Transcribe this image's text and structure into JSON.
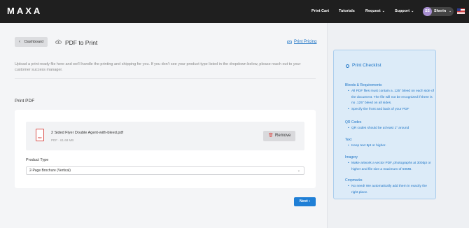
{
  "brand": "MAXA",
  "nav": [
    {
      "label": "Print Cart"
    },
    {
      "label": "Tutorials"
    },
    {
      "label": "Request"
    },
    {
      "label": "Support"
    }
  ],
  "user": {
    "initials": "SS",
    "name": "Sherin"
  },
  "header": {
    "back_label": "Dashboard",
    "title": "PDF to Print",
    "pricing_label": "Print Pricing"
  },
  "intro": "Upload a print-ready file here and we'll handle the printing and shipping for you. If you don't see your product type listed in the dropdown below, please reach out to your customer success manager.",
  "section_label": "Print PDF",
  "file": {
    "icon_text": "PDF",
    "name": "2 Sided Flyer Double Agent-with-bleed.pdf",
    "meta": "PDF · 61.68 MB",
    "remove_label": "Remove"
  },
  "product_type": {
    "label": "Product Type",
    "selected": "2-Page Brochure (Vertical)"
  },
  "next_label": "Next",
  "checklist": {
    "title": "Print Checklist",
    "sections": [
      {
        "heading": "Bleeds & Requirements",
        "items": [
          "All PDF files must contain a .125\" bleed on each side of the document. The file will not be recognized if there is no .125\" bleed on all sides.",
          "Specify the front and back of your PDF"
        ]
      },
      {
        "heading": "QR Codes",
        "items": [
          "QR codes should be at least 1\" around"
        ]
      },
      {
        "heading": "Text",
        "items": [
          "Keep text 8pt or higher."
        ]
      },
      {
        "heading": "Imagery",
        "items": [
          "Make artwork a vector PDF, photographs at 300dpi or higher and file size a maximum of 50MB."
        ]
      },
      {
        "heading": "Cropmarks",
        "items": [
          "No need! We automatically add them in exactly the right place."
        ]
      }
    ]
  },
  "colors": {
    "accent": "#1f7fd6",
    "link": "#1b73c5",
    "danger": "#d9534f",
    "topbar": "#1f1f1f"
  },
  "icons": {
    "back": "chevron-left-icon",
    "upload": "cloud-upload-icon",
    "pricing": "price-tag-icon",
    "file": "pdf-file-icon",
    "remove": "trash-icon",
    "select": "chevron-down-icon",
    "next": "chevron-right-icon",
    "checklist": "info-icon"
  }
}
